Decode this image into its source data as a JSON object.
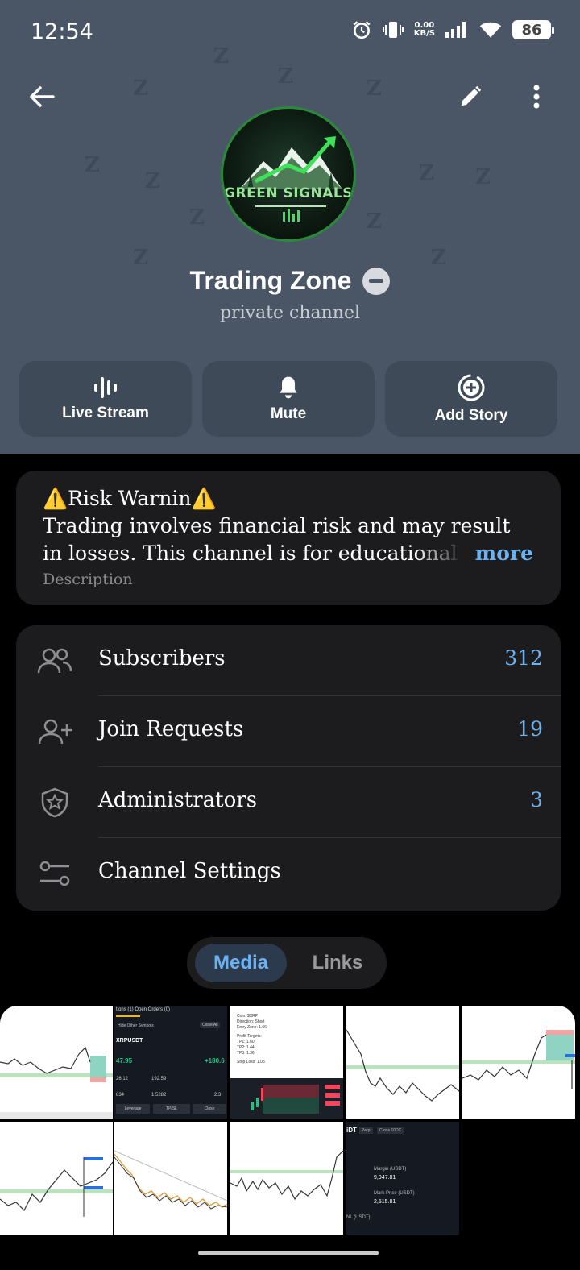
{
  "status_bar": {
    "time": "12:54",
    "net_speed_value": "0.00",
    "net_speed_unit": "KB/S",
    "battery": "86"
  },
  "header": {
    "background_color": "#4a5666",
    "avatar_logo_text": "GREEN SIGNALS",
    "channel_name": "Trading Zone",
    "channel_type": "private channel"
  },
  "actions": [
    {
      "label": "Live Stream",
      "icon": "live-stream-icon"
    },
    {
      "label": "Mute",
      "icon": "bell-icon"
    },
    {
      "label": "Add Story",
      "icon": "add-story-icon"
    }
  ],
  "description": {
    "title": "⚠️Risk Warnin⚠️",
    "line1": "Trading involves financial risk and may result",
    "line2": "in losses. This channel is for educational",
    "more": "more",
    "label": "Description"
  },
  "info_rows": [
    {
      "label": "Subscribers",
      "value": "312",
      "icon": "subscribers-icon"
    },
    {
      "label": "Join Requests",
      "value": "19",
      "icon": "add-user-icon"
    },
    {
      "label": "Administrators",
      "value": "3",
      "icon": "admin-shield-icon"
    },
    {
      "label": "Channel Settings",
      "value": "",
      "icon": "settings-sliders-icon"
    }
  ],
  "tabs": {
    "media": "Media",
    "links": "Links"
  },
  "accent_color": "#6ab2f2",
  "media_thumbnails": {
    "t2_header": "tions (1)   Open Orders (0)",
    "t2_hide": "Hide Other Symbols",
    "t2_closeall": "Close All",
    "t2_symbol": "XRPUSDT",
    "t2_value": "47.95",
    "t2_pct": "+180.6",
    "t2_size": "26.12",
    "t2_margin": "192.59",
    "t2_entry": "834",
    "t2_mark": "1.5282",
    "t2_liq": "2.3",
    "t2_btn1": "Leverage",
    "t2_btn2": "TP/SL",
    "t2_btn3": "Close",
    "t3_coin": "Coin: $XRP",
    "t3_dir": "Direction: Short",
    "t3_entry": "Entry Zone: 1.66",
    "t3_targets": "Profit Targets:",
    "t3_tp1": "TP1: 1.60",
    "t3_tp2": "TP2: 1.44",
    "t3_tp3": "TP3: 1.36",
    "t3_sl": "Stop Loss: 1.05",
    "t9_title": "iDT",
    "t9_tag1": "Perp",
    "t9_tag2": "Cross 10DX",
    "t9_margin_lbl": "Margin (USDT)",
    "t9_margin": "9,947.81",
    "t9_mark_lbl": "Mark Price (USDT)",
    "t9_mark": "2,515.81",
    "t9_pnl": "NL (USDT)"
  }
}
